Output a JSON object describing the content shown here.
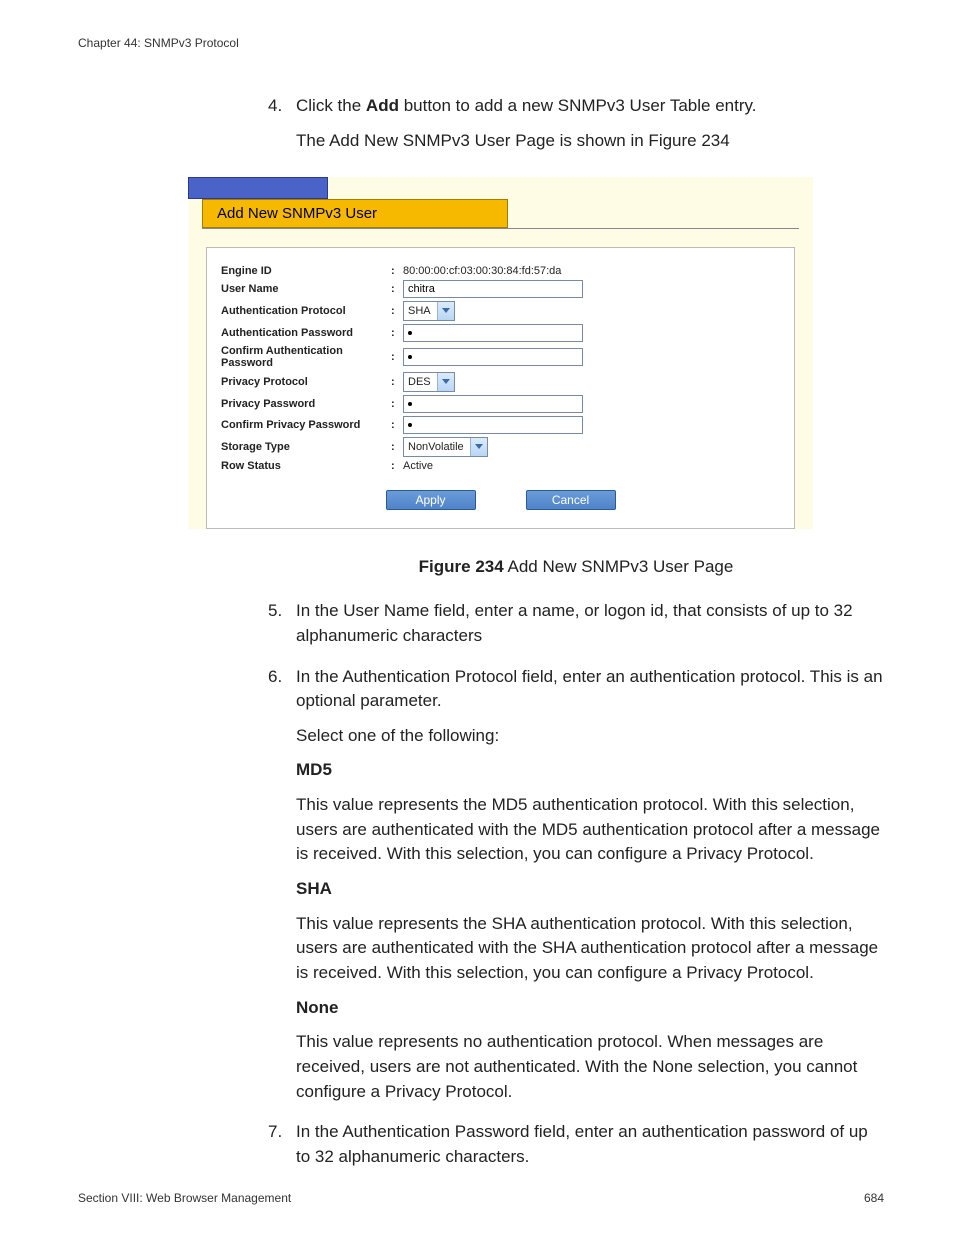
{
  "header": {
    "chapter": "Chapter 44: SNMPv3 Protocol"
  },
  "step4": {
    "num": "4.",
    "line1a": "Click the ",
    "line1b": "Add",
    "line1c": " button to add a new SNMPv3 User Table entry.",
    "line2": "The Add New SNMPv3 User Page is shown in Figure 234"
  },
  "panel": {
    "title": "Add New SNMPv3 User",
    "rows": {
      "engine_id": {
        "label": "Engine ID",
        "value": "80:00:00:cf:03:00:30:84:fd:57:da"
      },
      "user_name": {
        "label": "User Name",
        "value": "chitra"
      },
      "auth_proto": {
        "label": "Authentication Protocol",
        "value": "SHA"
      },
      "auth_pw": {
        "label": "Authentication Password"
      },
      "auth_pw_c": {
        "label": "Confirm Authentication Password"
      },
      "priv_proto": {
        "label": "Privacy Protocol",
        "value": "DES"
      },
      "priv_pw": {
        "label": "Privacy Password"
      },
      "priv_pw_c": {
        "label": "Confirm Privacy Password"
      },
      "storage": {
        "label": "Storage Type",
        "value": "NonVolatile"
      },
      "row_status": {
        "label": "Row Status",
        "value": "Active"
      }
    },
    "buttons": {
      "apply": "Apply",
      "cancel": "Cancel"
    }
  },
  "caption": {
    "bold": "Figure 234",
    "rest": "  Add New SNMPv3 User Page"
  },
  "step5": {
    "num": "5.",
    "text": "In the User Name field, enter a name, or logon id, that consists of up to 32 alphanumeric characters"
  },
  "step6": {
    "num": "6.",
    "line1": "In the Authentication Protocol field, enter an authentication protocol. This is an optional parameter.",
    "line2": "Select one of the following:",
    "opts": {
      "md5": {
        "title": "MD5",
        "text": "This value represents the MD5 authentication protocol. With this selection, users are authenticated with the MD5 authentication protocol after a message is received. With this selection, you can configure a Privacy Protocol."
      },
      "sha": {
        "title": "SHA",
        "text": "This value represents the SHA authentication protocol. With this selection, users are authenticated with the SHA authentication protocol after a message is received. With this selection, you can configure a Privacy Protocol."
      },
      "none": {
        "title": "None",
        "text": "This value represents no authentication protocol. When messages are received, users are not authenticated. With the None selection, you cannot configure a Privacy Protocol."
      }
    }
  },
  "step7": {
    "num": "7.",
    "text": "In the Authentication Password field, enter an authentication password of up to 32 alphanumeric characters."
  },
  "footer": {
    "section": "Section VIII: Web Browser Management",
    "page": "684"
  }
}
